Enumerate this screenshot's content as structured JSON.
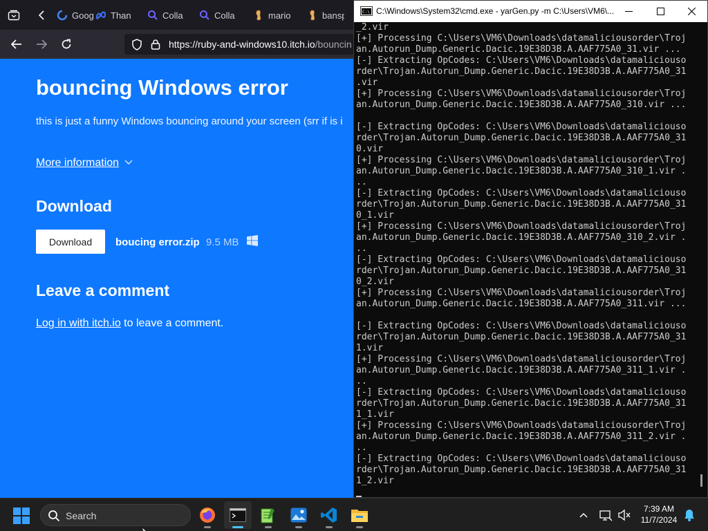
{
  "browser": {
    "tabs": [
      {
        "label": "Goog",
        "icon": "google-icon"
      },
      {
        "label": "Than",
        "icon": "meta-icon"
      },
      {
        "label": "Colla",
        "icon": "search-icon"
      },
      {
        "label": "Colla",
        "icon": "search-icon"
      },
      {
        "label": "mario",
        "icon": "peanut-icon"
      },
      {
        "label": "bansp",
        "icon": "peanut-icon"
      }
    ],
    "url_host": "https://ruby-and-windows10.itch.io",
    "url_path": "/bouncin"
  },
  "page": {
    "title": "bouncing Windows error",
    "description": "this is just a funny Windows bouncing around your screen (srr if is i",
    "more_info": "More information",
    "download_heading": "Download",
    "download_button": "Download",
    "file_name": "boucing error.zip",
    "file_size": "9.5 MB",
    "platform_icon": "windows-icon",
    "comment_heading": "Leave a comment",
    "login_link": "Log in with itch.io",
    "login_suffix": " to leave a comment."
  },
  "terminal": {
    "title": "C:\\Windows\\System32\\cmd.exe - yarGen.py  -m C:\\Users\\VM6\\...",
    "lines": [
      "_2.vir",
      "[+] Processing C:\\Users\\VM6\\Downloads\\datamaliciousorder\\Troj",
      "an.Autorun_Dump.Generic.Dacic.19E38D3B.A.AAF775A0_31.vir ...",
      "[-] Extracting OpCodes: C:\\Users\\VM6\\Downloads\\datamaliciouso",
      "rder\\Trojan.Autorun_Dump.Generic.Dacic.19E38D3B.A.AAF775A0_31",
      ".vir",
      "[+] Processing C:\\Users\\VM6\\Downloads\\datamaliciousorder\\Troj",
      "an.Autorun_Dump.Generic.Dacic.19E38D3B.A.AAF775A0_310.vir ...",
      "",
      "[-] Extracting OpCodes: C:\\Users\\VM6\\Downloads\\datamaliciouso",
      "rder\\Trojan.Autorun_Dump.Generic.Dacic.19E38D3B.A.AAF775A0_31",
      "0.vir",
      "[+] Processing C:\\Users\\VM6\\Downloads\\datamaliciousorder\\Troj",
      "an.Autorun_Dump.Generic.Dacic.19E38D3B.A.AAF775A0_310_1.vir .",
      "..",
      "[-] Extracting OpCodes: C:\\Users\\VM6\\Downloads\\datamaliciouso",
      "rder\\Trojan.Autorun_Dump.Generic.Dacic.19E38D3B.A.AAF775A0_31",
      "0_1.vir",
      "[+] Processing C:\\Users\\VM6\\Downloads\\datamaliciousorder\\Troj",
      "an.Autorun_Dump.Generic.Dacic.19E38D3B.A.AAF775A0_310_2.vir .",
      "..",
      "[-] Extracting OpCodes: C:\\Users\\VM6\\Downloads\\datamaliciouso",
      "rder\\Trojan.Autorun_Dump.Generic.Dacic.19E38D3B.A.AAF775A0_31",
      "0_2.vir",
      "[+] Processing C:\\Users\\VM6\\Downloads\\datamaliciousorder\\Troj",
      "an.Autorun_Dump.Generic.Dacic.19E38D3B.A.AAF775A0_311.vir ...",
      "",
      "[-] Extracting OpCodes: C:\\Users\\VM6\\Downloads\\datamaliciouso",
      "rder\\Trojan.Autorun_Dump.Generic.Dacic.19E38D3B.A.AAF775A0_31",
      "1.vir",
      "[+] Processing C:\\Users\\VM6\\Downloads\\datamaliciousorder\\Troj",
      "an.Autorun_Dump.Generic.Dacic.19E38D3B.A.AAF775A0_311_1.vir .",
      "..",
      "[-] Extracting OpCodes: C:\\Users\\VM6\\Downloads\\datamaliciouso",
      "rder\\Trojan.Autorun_Dump.Generic.Dacic.19E38D3B.A.AAF775A0_31",
      "1_1.vir",
      "[+] Processing C:\\Users\\VM6\\Downloads\\datamaliciousorder\\Troj",
      "an.Autorun_Dump.Generic.Dacic.19E38D3B.A.AAF775A0_311_2.vir .",
      "..",
      "[-] Extracting OpCodes: C:\\Users\\VM6\\Downloads\\datamaliciouso",
      "rder\\Trojan.Autorun_Dump.Generic.Dacic.19E38D3B.A.AAF775A0_31",
      "1_2.vir"
    ]
  },
  "taskbar": {
    "search_label": "Search",
    "apps": [
      "firefox-icon",
      "terminal-icon",
      "notepad-plus-icon",
      "photos-icon",
      "vscode-icon",
      "file-explorer-icon"
    ],
    "time": "7:39 AM",
    "date": "11/7/2024"
  },
  "colors": {
    "page_bg": "#0e78ff",
    "terminal_bg": "#0c0c0c",
    "taskbar_bg": "#1f1f1f"
  }
}
